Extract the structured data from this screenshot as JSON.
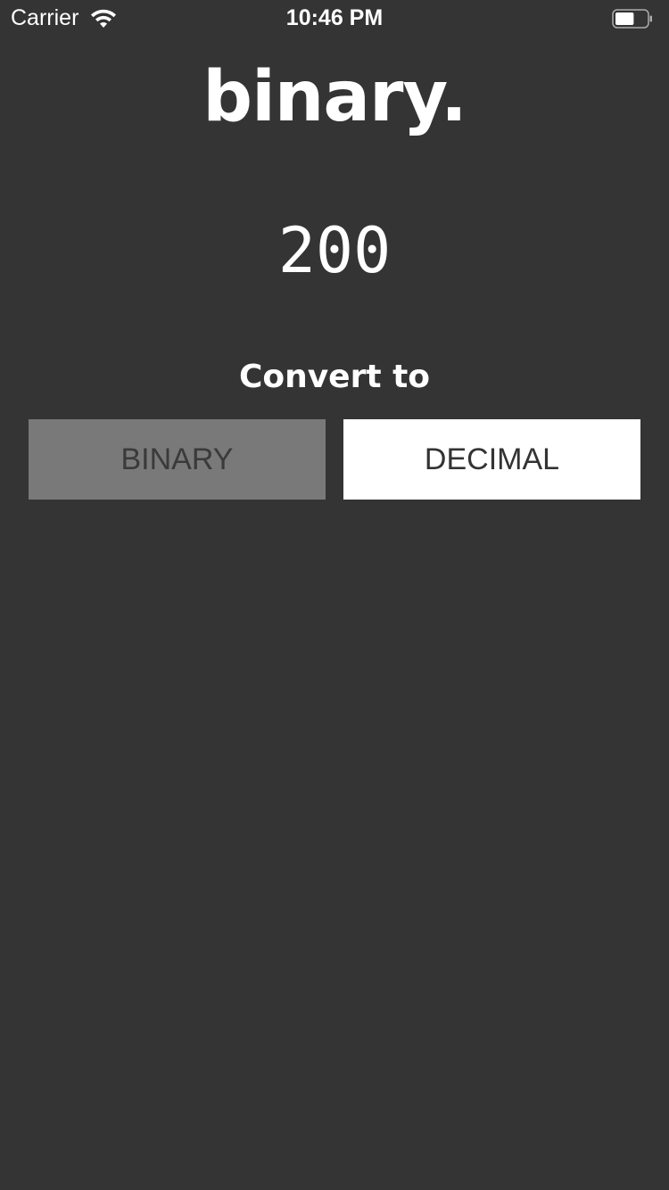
{
  "status_bar": {
    "carrier": "Carrier",
    "time": "10:46 PM",
    "wifi_icon": "wifi-icon",
    "battery_icon": "battery-icon",
    "battery_level": 0.6
  },
  "app": {
    "title": "binary.",
    "input_value": "200",
    "convert_label": "Convert to",
    "buttons": {
      "binary_label": "BINARY",
      "decimal_label": "DECIMAL"
    }
  },
  "colors": {
    "background": "#343434",
    "binary_button_bg": "#797979",
    "decimal_button_bg": "#ffffff",
    "text": "#ffffff"
  }
}
